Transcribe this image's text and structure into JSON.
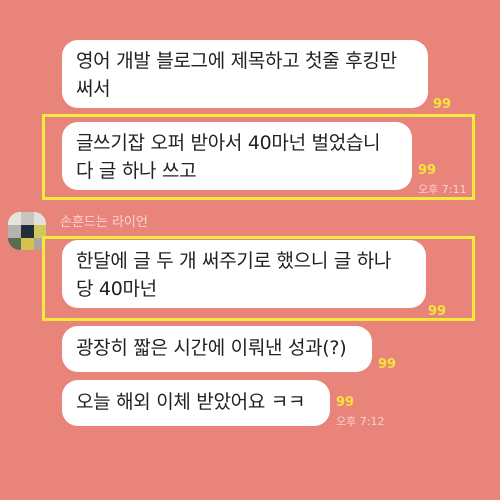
{
  "chat": {
    "messages": [
      {
        "lines": [
          "영어 개발 블로그에 제목하고 첫줄 후킹만",
          "써서"
        ],
        "unread": "99"
      },
      {
        "lines": [
          "글쓰기잡 오퍼 받아서 40마넌 벌었습니",
          "다 글 하나 쓰고"
        ],
        "unread": "99",
        "time": "오후 7:11"
      },
      {
        "lines": [
          "한달에 글 두 개 써주기로 했으니 글 하나",
          "당 40마넌"
        ],
        "unread": "99"
      },
      {
        "lines": [
          "광장히 짧은 시간에 이뤄낸 성과(?)"
        ],
        "unread": "99"
      },
      {
        "lines": [
          "오늘 해외 이체 받았어요 ㅋㅋ"
        ],
        "unread": "99",
        "time": "오후 7:12"
      }
    ],
    "sender_name": "손흔드는 라이언"
  },
  "colors": {
    "background": "#e9847b",
    "bubble": "#ffffff",
    "highlight": "#f4ea3c",
    "unread": "#f6e33b"
  }
}
